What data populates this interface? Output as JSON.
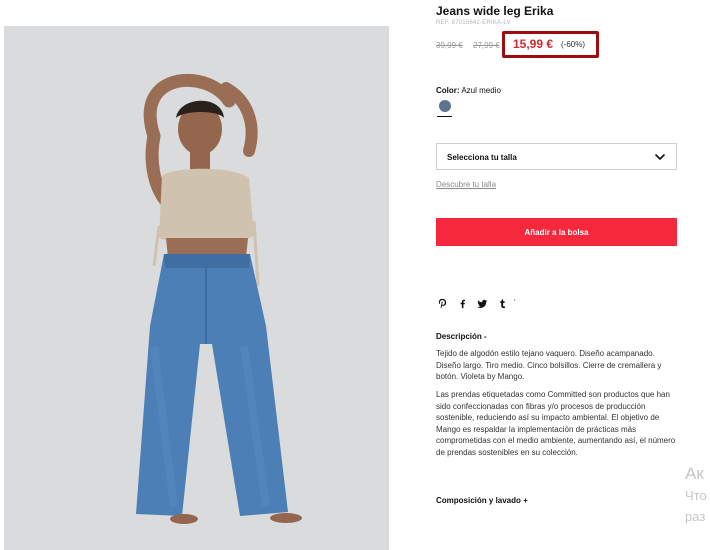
{
  "product": {
    "title": "Jeans wide leg Erika",
    "ref": "REF. 87015642-ERIKA-LV",
    "old_price_1": "39,99 €",
    "old_price_2": "27,99 €",
    "price": "15,99 €",
    "discount": "(-60%)"
  },
  "color": {
    "label": "Color:",
    "value": "Azul medio",
    "swatch_hex": "#5f7391"
  },
  "size": {
    "select_label": "Selecciona tu talla",
    "guide_link": "Descubre tu talla"
  },
  "cart": {
    "add_label": "Añadir a la bolsa"
  },
  "social": {
    "icons": [
      "pinterest-icon",
      "facebook-icon",
      "twitter-icon",
      "tumblr-icon"
    ]
  },
  "description": {
    "heading": "Descripción -",
    "p1": "Tejido de algodón estilo tejano vaquero. Diseño acampanado. Diseño largo. Tiro medio. Cinco bolsillos. Cierre de cremallera y botón. Violeta by Mango.",
    "p2": "Las prendas etiquetadas como Committed son productos que han sido confeccionadas con fibras y/o procesos de producción sostenible, reduciendo así su impacto ambiental. El objetivo de Mango es respaldar la implementación de prácticas más comprometidas con el medio ambiente, aumentando así, el número de prendas sostenibles en su colección."
  },
  "composition": {
    "heading": "Composición y lavado +"
  },
  "watermark": {
    "line1": "Ак",
    "line2": "Что",
    "line3": "раз"
  },
  "colors": {
    "sale_red": "#d5262f",
    "highlight_box": "#9b0d10",
    "button_red": "#f5283c"
  }
}
